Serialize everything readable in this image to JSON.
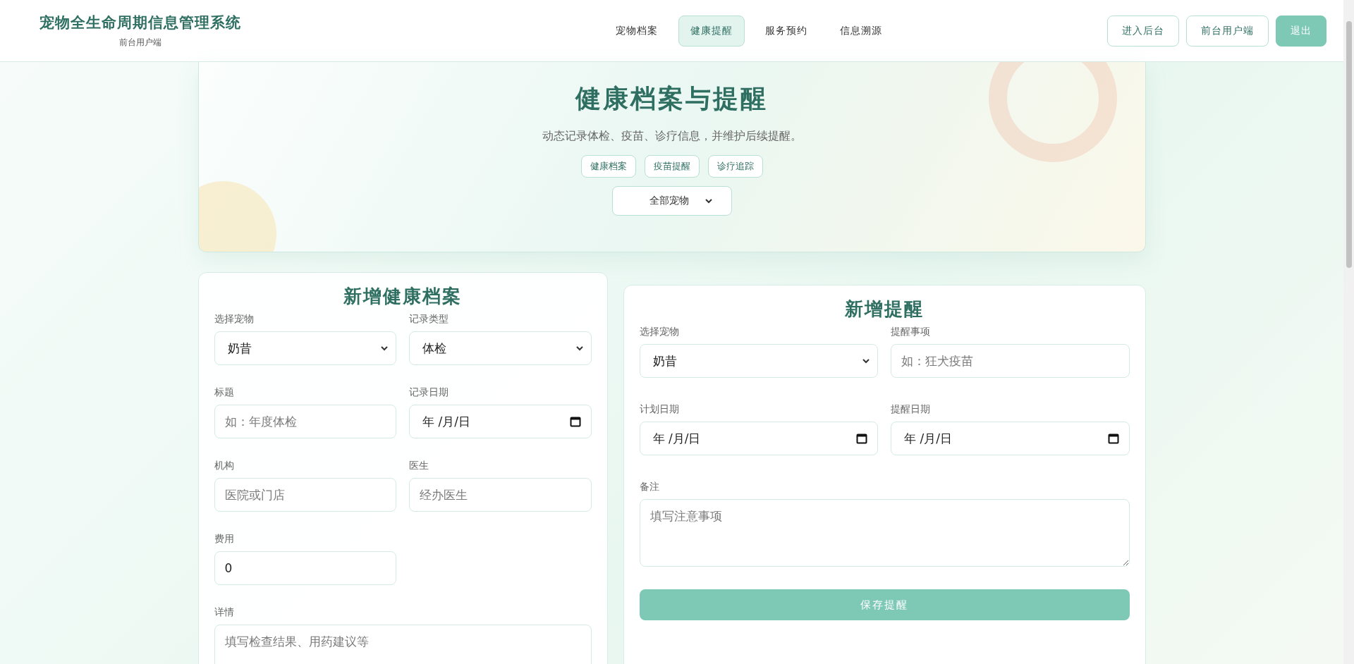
{
  "header": {
    "title": "宠物全生命周期信息管理系统",
    "subtitle": "前台用户端",
    "nav": [
      {
        "label": "宠物档案",
        "selected": false
      },
      {
        "label": "健康提醒",
        "selected": true
      },
      {
        "label": "服务预约",
        "selected": false
      },
      {
        "label": "信息溯源",
        "selected": false
      }
    ],
    "actions": [
      {
        "label": "进入后台",
        "kind": "outline"
      },
      {
        "label": "前台用户端",
        "kind": "outline"
      },
      {
        "label": "退出",
        "kind": "primary"
      }
    ]
  },
  "hero": {
    "title": "健康档案与提醒",
    "description": "动态记录体检、疫苗、诊疗信息，并维护后续提醒。",
    "tags": [
      "健康档案",
      "疫苗提醒",
      "诊疗追踪"
    ],
    "filter": "全部宠物"
  },
  "record_form": {
    "title": "新增健康档案",
    "fields": [
      {
        "label": "选择宠物",
        "kind": "select",
        "value": "奶昔"
      },
      {
        "label": "记录类型",
        "kind": "select",
        "value": "体检"
      },
      {
        "label": "标题",
        "kind": "text",
        "placeholder": "如：年度体检"
      },
      {
        "label": "记录日期",
        "kind": "date",
        "value": "年 /月/日"
      },
      {
        "label": "机构",
        "kind": "text",
        "placeholder": "医院或门店"
      },
      {
        "label": "医生",
        "kind": "text",
        "placeholder": "经办医生"
      },
      {
        "label": "费用",
        "kind": "text",
        "value": "0"
      },
      {
        "label": "详情",
        "kind": "textarea",
        "placeholder": "填写检查结果、用药建议等"
      }
    ]
  },
  "reminder_form": {
    "title": "新增提醒",
    "fields": [
      {
        "label": "选择宠物",
        "kind": "select",
        "value": "奶昔"
      },
      {
        "label": "提醒事项",
        "kind": "text",
        "placeholder": "如：狂犬疫苗"
      },
      {
        "label": "计划日期",
        "kind": "date",
        "value": "年 /月/日"
      },
      {
        "label": "提醒日期",
        "kind": "date",
        "value": "年 /月/日"
      },
      {
        "label": "备注",
        "kind": "textarea",
        "placeholder": "填写注意事项"
      }
    ],
    "submit": "保存提醒"
  }
}
